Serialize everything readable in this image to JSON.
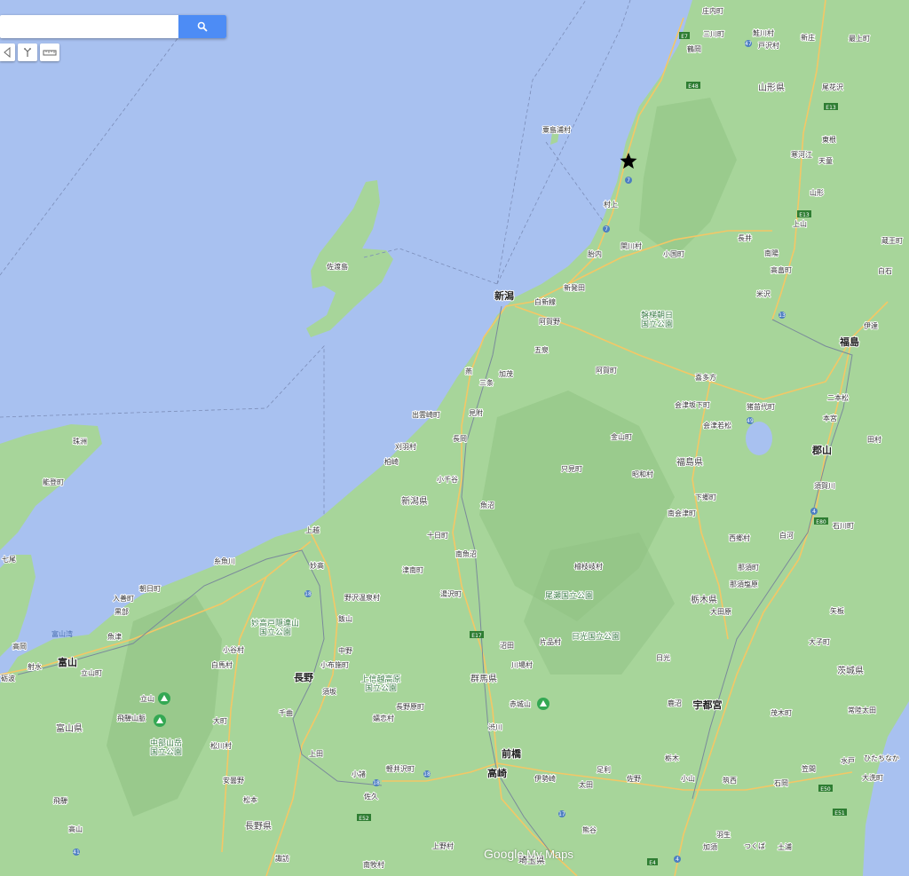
{
  "search": {
    "placeholder": ""
  },
  "tools": {
    "icons": [
      "marker-icon",
      "directions-icon",
      "ruler-icon"
    ]
  },
  "branding": {
    "logo_google": "Google",
    "logo_product": "My Maps"
  },
  "colors": {
    "sea": "#a8c1f0",
    "land": "#a7d59a",
    "mountain": "#8fc283",
    "road": "#f4c766",
    "rail": "#7a8a9a",
    "accent": "#4d8cf5"
  },
  "marker": {
    "type": "star",
    "icon": "star-icon"
  },
  "labels": {
    "niigata": "新潟",
    "sado": "佐渡島",
    "awashima": "粟島浦村",
    "murakami": "村上",
    "sekikawa": "関川村",
    "tainai": "胎内",
    "oguni": "小国町",
    "shibata": "新発田",
    "shirone": "白新線",
    "agano": "阿賀野",
    "gosen": "五泉",
    "bandai": "磐梯朝日\n国立公園",
    "agamachi": "阿賀町",
    "tsubame": "燕",
    "sanjo": "三条",
    "kamo": "加茂",
    "izumozaki": "出雲崎町",
    "mitsuke": "見附",
    "nagaoka": "長岡",
    "kariwa": "刈羽村",
    "kashiwazaki": "柏崎",
    "ojiya": "小千谷",
    "niigata_pref": "新潟県",
    "uonuma": "魚沼",
    "tokamachi": "十日町",
    "joetsu": "上越",
    "minamiuonuma": "南魚沼",
    "tsunan": "津南町",
    "itoigawa": "糸魚川",
    "myoko": "妙高",
    "nozawa": "野沢温泉村",
    "yuzawa": "湯沢町",
    "myoko_park": "妙高戸隠連山\n国立公園",
    "iiyama": "飯山",
    "nakano": "中野",
    "obuse": "小布施町",
    "nagano": "長野",
    "suzaka": "須坂",
    "joshin": "上信越高原\n国立公園",
    "tsumagoi": "嬬恋村",
    "naganohara": "長野原町",
    "chikuma": "千曲",
    "ueda": "上田",
    "karuizawa": "軽井沢町",
    "komoro": "小諸",
    "saku": "佐久",
    "gunma": "群馬県",
    "akagi": "赤城山",
    "numata": "沼田",
    "shibukawa": "渋川",
    "maebashi": "前橋",
    "takasaki": "高崎",
    "isesaki": "伊勢崎",
    "ota": "太田",
    "ashikaga": "足利",
    "sano": "佐野",
    "tochigi": "栃木",
    "oyama": "小山",
    "kumagaya": "熊谷",
    "saitama": "埼玉県",
    "oze": "尾瀬国立公園",
    "nikko_park": "日光国立公園",
    "katashina": "片品村",
    "kawaba": "川場村",
    "nikko": "日光",
    "kanuma": "鹿沼",
    "utsunomiya": "宇都宮",
    "tochigi_pref": "栃木県",
    "ohtawara": "大田原",
    "nasushiobara": "那須塩原",
    "nasu": "那須町",
    "shirakawa": "白河",
    "nishigo": "西郷村",
    "minamiaizu": "南会津町",
    "tadami": "只見町",
    "showa": "昭和村",
    "hinoemata": "檜枝岐村",
    "shimogo": "下郷町",
    "fukushima_pref": "福島県",
    "kaneyama": "金山町",
    "aizuwakamatsu": "会津若松",
    "aizubange": "会津坂下町",
    "kitakata": "喜多方",
    "inawashiro": "猪苗代町",
    "koriyama": "郡山",
    "sukagawa": "須賀川",
    "ishikawa": "石川町",
    "motomiya": "本宮",
    "nihonmatsu": "二本松",
    "fukushima": "福島",
    "date": "伊達",
    "yonezawa": "米沢",
    "takahata": "高畠町",
    "nanyo": "南陽",
    "nagai": "長井",
    "kaminoyama": "上山",
    "yamagata": "山形",
    "tendo": "天童",
    "sagae": "寒河江",
    "higashine": "東根",
    "obanazawa": "尾花沢",
    "yamagata_pref": "山形県",
    "shinjo": "新庄",
    "mogami": "最上町",
    "tozawa": "戸沢村",
    "sakegawa": "鮭川村",
    "tsuruoka": "鶴岡",
    "mikawa": "三川町",
    "shonai": "庄内町",
    "zao": "蔵王町",
    "shiroishi": "白石",
    "tamura": "田村",
    "ibaraki": "茨城県",
    "daigo": "大子町",
    "hitachiota": "常陸太田",
    "mito": "水戸",
    "hitachinaka": "ひたちなか",
    "oarai": "大洗町",
    "kasama": "笠間",
    "chikusei": "筑西",
    "motegi": "茂木町",
    "yaita": "矢板",
    "ishioka": "石岡",
    "tsukuba": "つくば",
    "tsuchiura": "土浦",
    "toyama": "富山",
    "toyama_pref": "富山県",
    "tateyama": "立山",
    "hida": "飛騨山脈",
    "chubu": "中部山岳\n国立公園",
    "omachi": "大町",
    "matsukawa": "松川村",
    "azumino": "安曇野",
    "matsumoto": "松本",
    "nagano_pref": "長野県",
    "hakuba": "白馬村",
    "otari": "小谷村",
    "nyuzen": "入善町",
    "kurobe": "黒部",
    "asahi": "朝日町",
    "uozu": "魚津",
    "toyamawan": "富山湾",
    "takaoka": "高岡",
    "imizu": "射水",
    "tonami": "砺波",
    "tateyamamachi": "立山町",
    "suzu": "珠洲",
    "noto": "能登町",
    "nanao": "七尾",
    "hida_city": "飛騨",
    "takayama": "高山",
    "suwa": "諏訪",
    "minamimaki": "南牧村",
    "kamino": "上野村",
    "chichibu": "小鹿野町",
    "kazo": "加須",
    "koshigaya": "羽生"
  }
}
